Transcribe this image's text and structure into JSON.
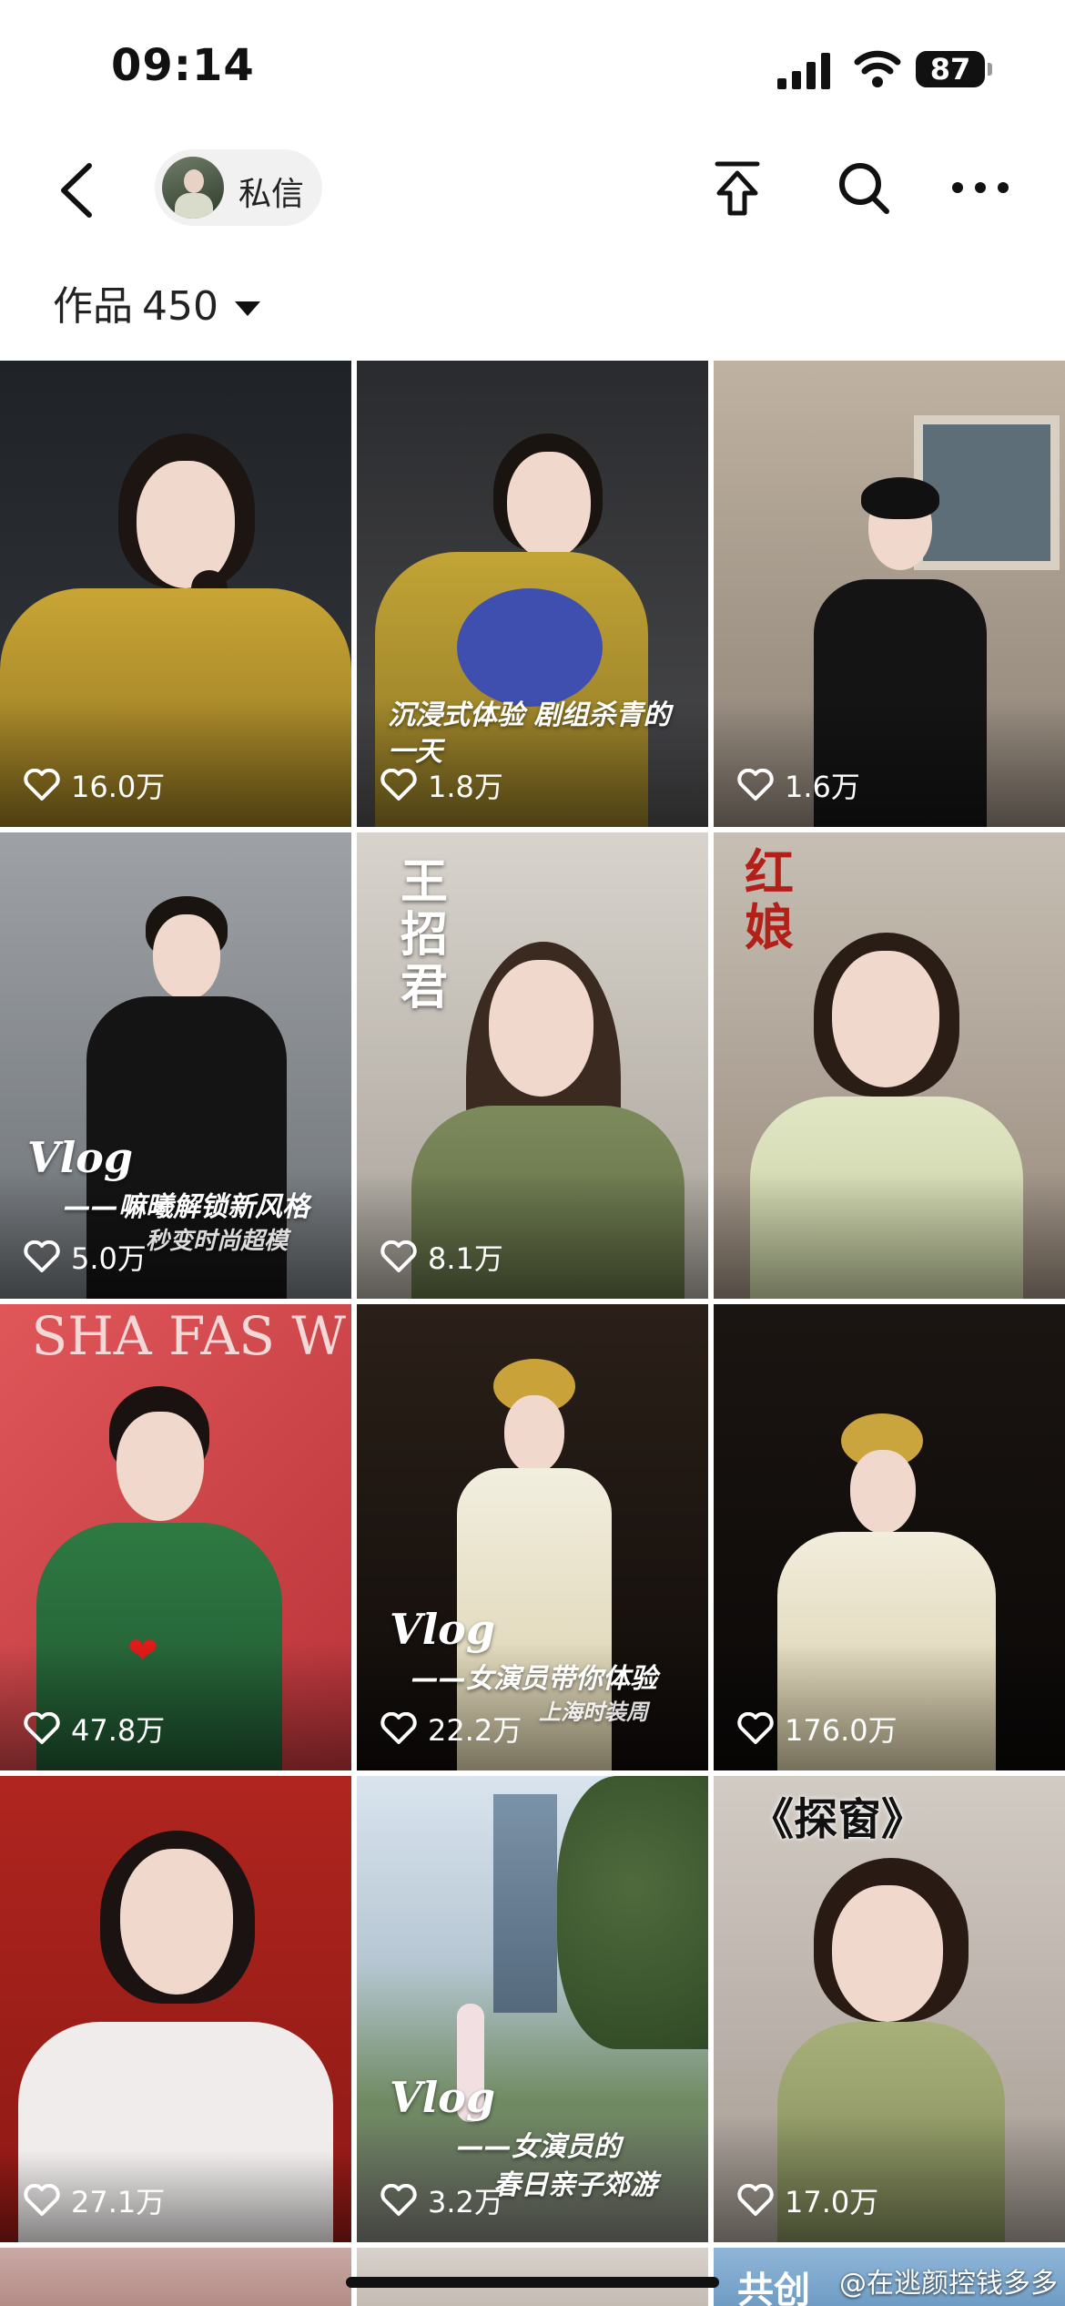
{
  "status_bar": {
    "time": "09:14",
    "battery": "87"
  },
  "nav": {
    "private_message": "私信"
  },
  "works": {
    "label": "作品",
    "count": "450"
  },
  "icons": [
    "back-icon",
    "share-icon",
    "search-icon",
    "more-icon",
    "heart-icon",
    "signal-icon",
    "wifi-icon",
    "battery-icon"
  ],
  "tiles": [
    {
      "likes": "16.0万"
    },
    {
      "likes": "1.8万",
      "caption": "沉浸式体验 剧组杀青的一天"
    },
    {
      "likes": "1.6万"
    },
    {
      "likes": "5.0万",
      "vlog": "Vlog",
      "caption": "——嘛曦解锁新风格",
      "subcaption": "秒变时尚超模"
    },
    {
      "likes": "8.1万",
      "title": "王招君"
    },
    {
      "likes": "",
      "title": "红娘"
    },
    {
      "likes": "47.8万",
      "backdrop": "SHA FAS W"
    },
    {
      "likes": "22.2万",
      "vlog": "Vlog",
      "caption": "——女演员带你体验",
      "subcaption": "上海时装周"
    },
    {
      "likes": "176.0万"
    },
    {
      "likes": "27.1万"
    },
    {
      "likes": "3.2万",
      "vlog": "Vlog",
      "caption": "——女演员的",
      "subcaption": "春日亲子郊游"
    },
    {
      "likes": "17.0万",
      "title": "《探窗》"
    }
  ],
  "watermark": "@在逃颜控钱多多",
  "bottom_partial": "共创"
}
